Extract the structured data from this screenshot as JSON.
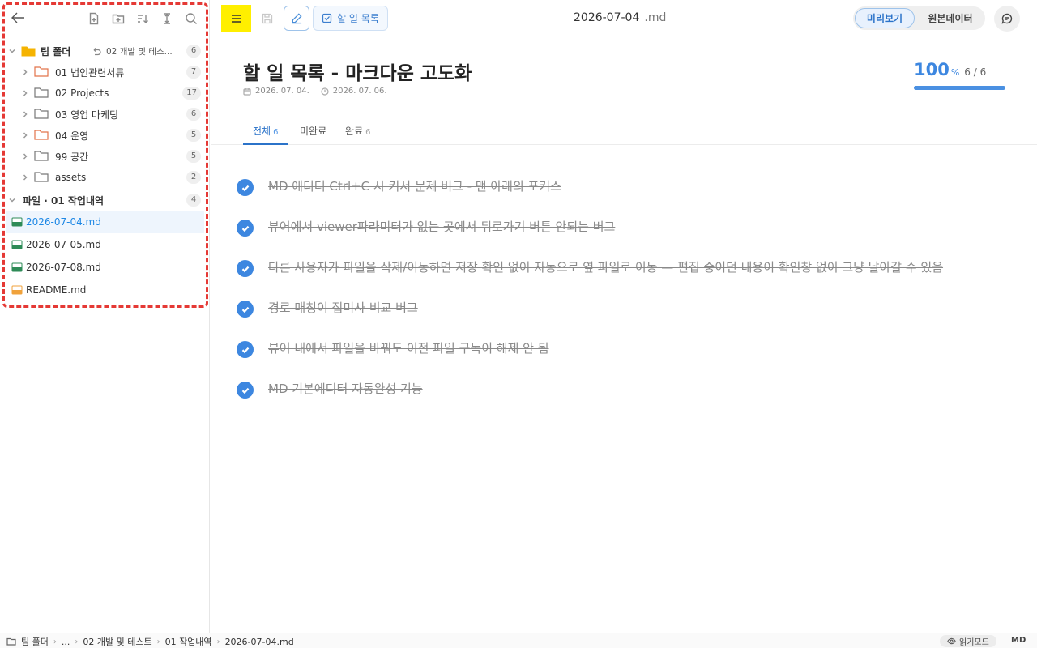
{
  "sidebar": {
    "team": {
      "label": "팀 폴더",
      "path_hint": "02 개발 및 테스...",
      "count": "6"
    },
    "folders": [
      {
        "label": "01 법인관련서류",
        "count": "7",
        "color": "#e2734a"
      },
      {
        "label": "02 Projects",
        "count": "17",
        "color": "#777777"
      },
      {
        "label": "03 영업 마케팅",
        "count": "6",
        "color": "#777777"
      },
      {
        "label": "04 운영",
        "count": "5",
        "color": "#e2734a"
      },
      {
        "label": "99 공간",
        "count": "5",
        "color": "#777777"
      },
      {
        "label": "assets",
        "count": "2",
        "color": "#777777"
      }
    ],
    "files_section": {
      "label": "파일 · 01 작업내역",
      "count": "4"
    },
    "files": [
      {
        "label": "2026-07-04.md",
        "active": true
      },
      {
        "label": "2026-07-05.md",
        "active": false
      },
      {
        "label": "2026-07-08.md",
        "active": false
      },
      {
        "label": "README.md",
        "active": false
      }
    ]
  },
  "topbar": {
    "todo_chip": "할 일 목록",
    "doc_title": "2026-07-04",
    "doc_ext": ".md",
    "preview_label": "미리보기",
    "raw_label": "원본데이터"
  },
  "main": {
    "title": "할 일 목록 - 마크다운 고도화",
    "created": "2026. 07. 04.",
    "updated": "2026. 07. 06.",
    "progress": {
      "percent": "100",
      "percent_symbol": "%",
      "fraction": "6 / 6",
      "fill": 1.0
    },
    "tabs": [
      {
        "label": "전체",
        "count": "6",
        "active": true
      },
      {
        "label": "미완료",
        "count": "",
        "active": false
      },
      {
        "label": "완료",
        "count": "6",
        "active": false
      }
    ],
    "tasks": [
      "MD 에디터 Ctrl+C 시 커서 문제 버그 - 맨 아래의 포커스",
      "뷰어에서 viewer파라미터가 없는 곳에서 뒤로가기 버튼 안되는 버그",
      "다른 사용자가 파일을 삭제/이동하면 저장 확인 없이 자동으로 옆 파일로 이동 — 편집 중이던 내용이 확인창 없이 그냥 날아갈 수 있음",
      "경로 매칭이 접미사 비교 버그",
      "뷰어 내에서 파일을 바꿔도 이전 파일 구독이 해제 안 됨",
      "MD 기본에디터 자동완성 기능"
    ]
  },
  "statusbar": {
    "crumbs": [
      "팀 폴더",
      "...",
      "02 개발 및 테스트",
      "01 작업내역",
      "2026-07-04.md"
    ],
    "read_mode": "읽기모드",
    "format": "MD"
  },
  "colors": {
    "accent": "#3d87e0",
    "highlight": "#ffef00",
    "annotation": "#e53935"
  }
}
